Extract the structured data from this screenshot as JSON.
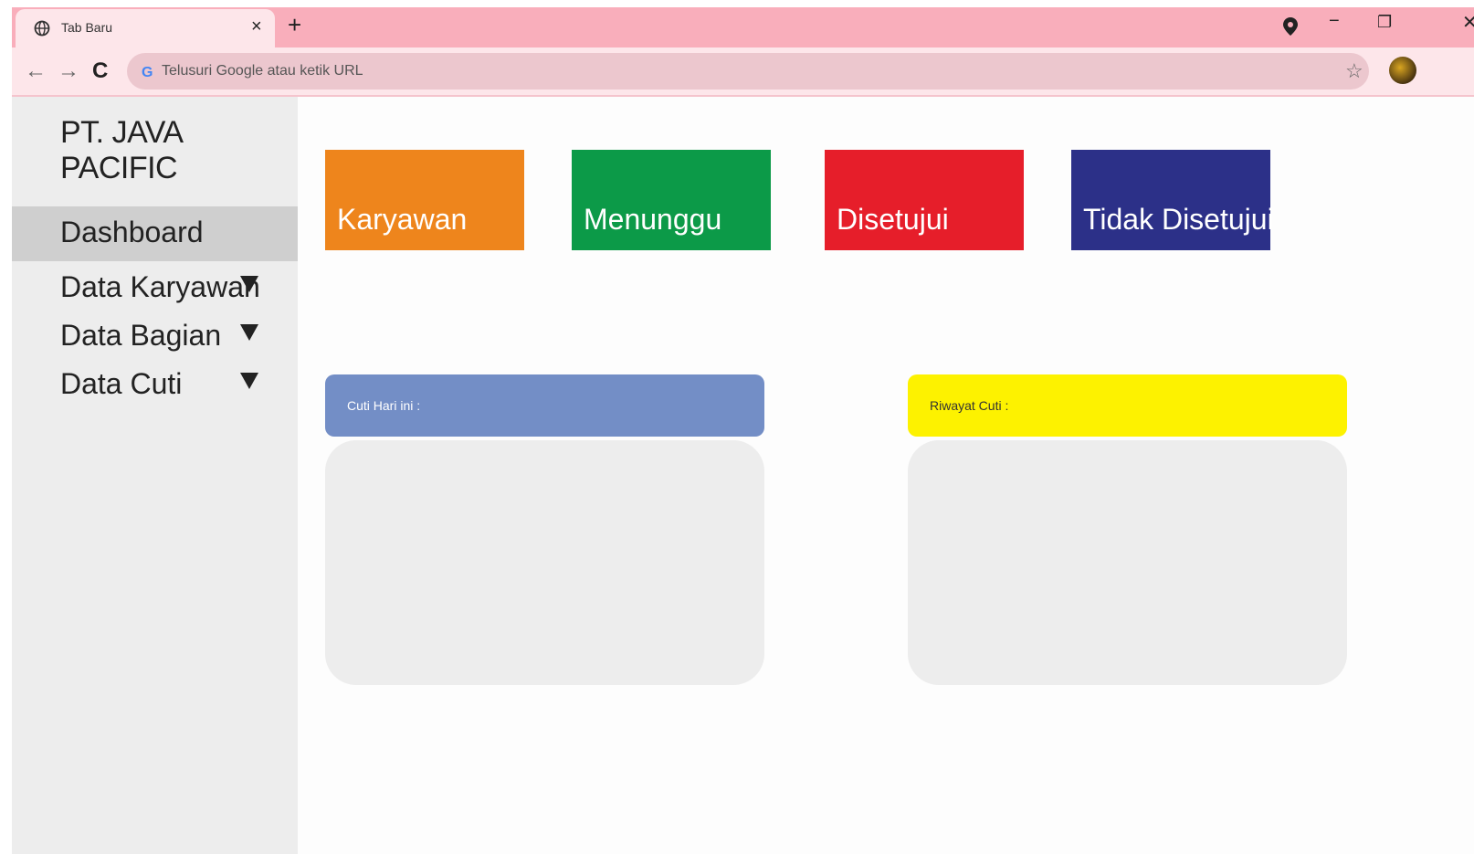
{
  "browser": {
    "tab_title": "Tab Baru",
    "tab_close": "×",
    "new_tab": "+",
    "minimize": "−",
    "restore": "❐",
    "close": "✕",
    "back": "←",
    "forward": "→",
    "reload": "C",
    "address_placeholder": "Telusuri Google atau ketik URL",
    "bookmark": "☆"
  },
  "sidebar": {
    "brand": "PT. JAVA PACIFIC",
    "items": [
      {
        "label": "Dashboard",
        "active": true,
        "dropdown": false
      },
      {
        "label": "Data Karyawan",
        "active": false,
        "dropdown": true
      },
      {
        "label": "Data Bagian",
        "active": false,
        "dropdown": true
      },
      {
        "label": "Data Cuti",
        "active": false,
        "dropdown": true
      }
    ]
  },
  "cards": [
    {
      "label": "Karyawan",
      "color": "#ee851c"
    },
    {
      "label": "Menunggu",
      "color": "#0c9a48"
    },
    {
      "label": "Disetujui",
      "color": "#e61e2a"
    },
    {
      "label": "Tidak Disetujui",
      "color": "#2c3088"
    }
  ],
  "panels": [
    {
      "title": "Cuti Hari ini :",
      "header_color": "#738ec6",
      "title_color": "#ffffff"
    },
    {
      "title": "Riwayat Cuti :",
      "header_color": "#fdf200",
      "title_color": "#333333"
    }
  ]
}
